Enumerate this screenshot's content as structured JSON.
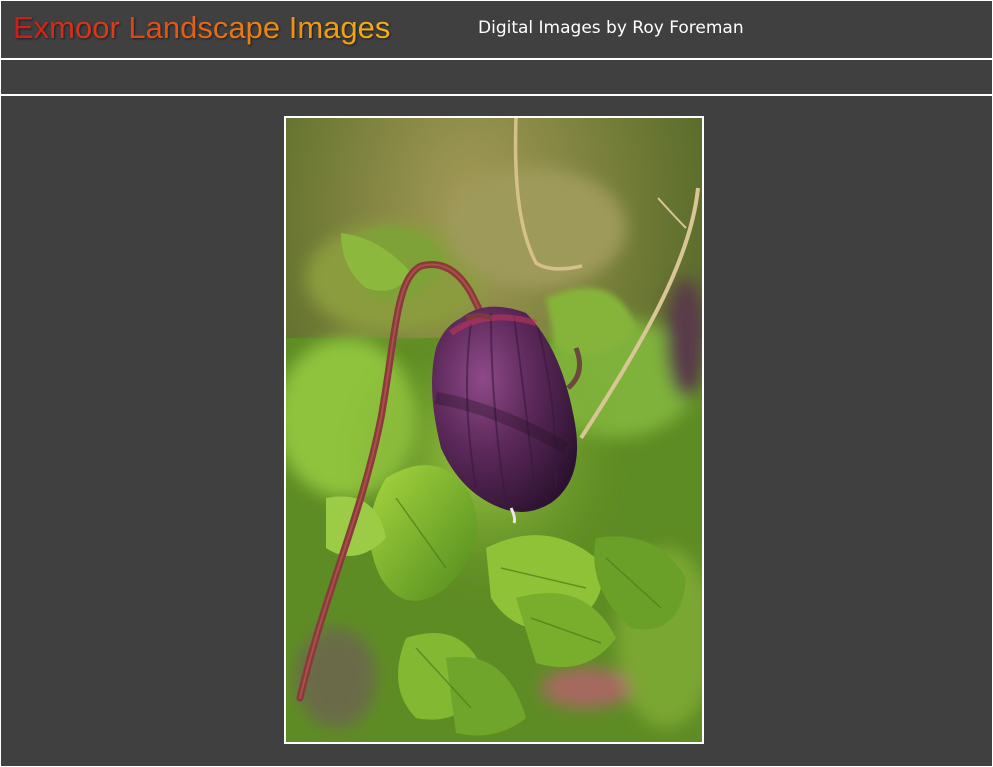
{
  "header": {
    "title": "Exmoor Landscape Images",
    "subtitle": "Digital Images by Roy Foreman"
  },
  "nav": {
    "items": []
  },
  "photo": {
    "subject": "purple-flower-bud-photo"
  },
  "colors": {
    "background": "#404040",
    "rule": "#ffffff",
    "title_gradient_start": "#cc1c1c",
    "title_gradient_end": "#f2b218",
    "subtitle": "#ffffff"
  }
}
